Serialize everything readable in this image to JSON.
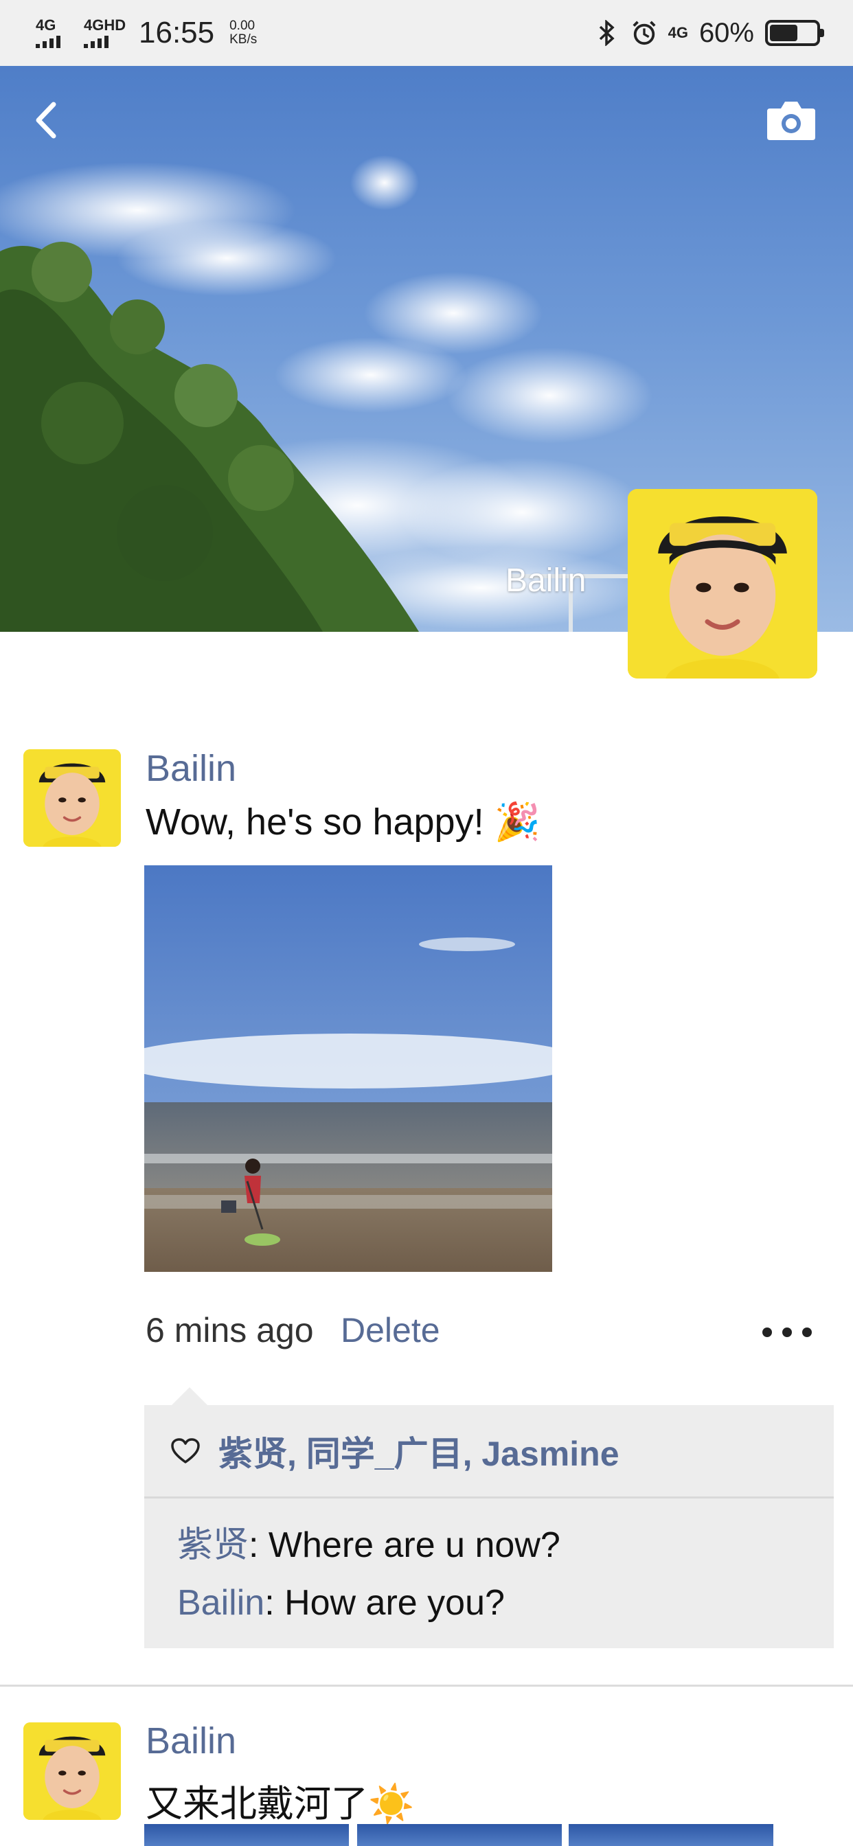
{
  "status_bar": {
    "sim1": "4G",
    "sim2": "4GHD",
    "time": "16:55",
    "speed_value": "0.00",
    "speed_unit": "KB/s",
    "net_type": "4G",
    "battery_percent": "60%",
    "battery_level": 0.6
  },
  "cover": {
    "owner_name": "Bailin",
    "back_icon": "chevron-left-icon",
    "camera_icon": "camera-icon"
  },
  "posts": [
    {
      "author": "Bailin",
      "text": "Wow, he's so happy! 🎉",
      "time": "6 mins ago",
      "delete_label": "Delete",
      "likes": "紫贤, 同学_广目, Jasmine",
      "comments": [
        {
          "name": "紫贤",
          "text": ": Where are u now?"
        },
        {
          "name": "Bailin",
          "text": ": How are you?"
        }
      ]
    },
    {
      "author": "Bailin",
      "text": "又来北戴河了☀️"
    }
  ],
  "colors": {
    "link": "#576b95",
    "status_bar_bg": "#f0f0f0",
    "interaction_bg": "#ededed",
    "avatar_bg": "#f6df2f"
  }
}
